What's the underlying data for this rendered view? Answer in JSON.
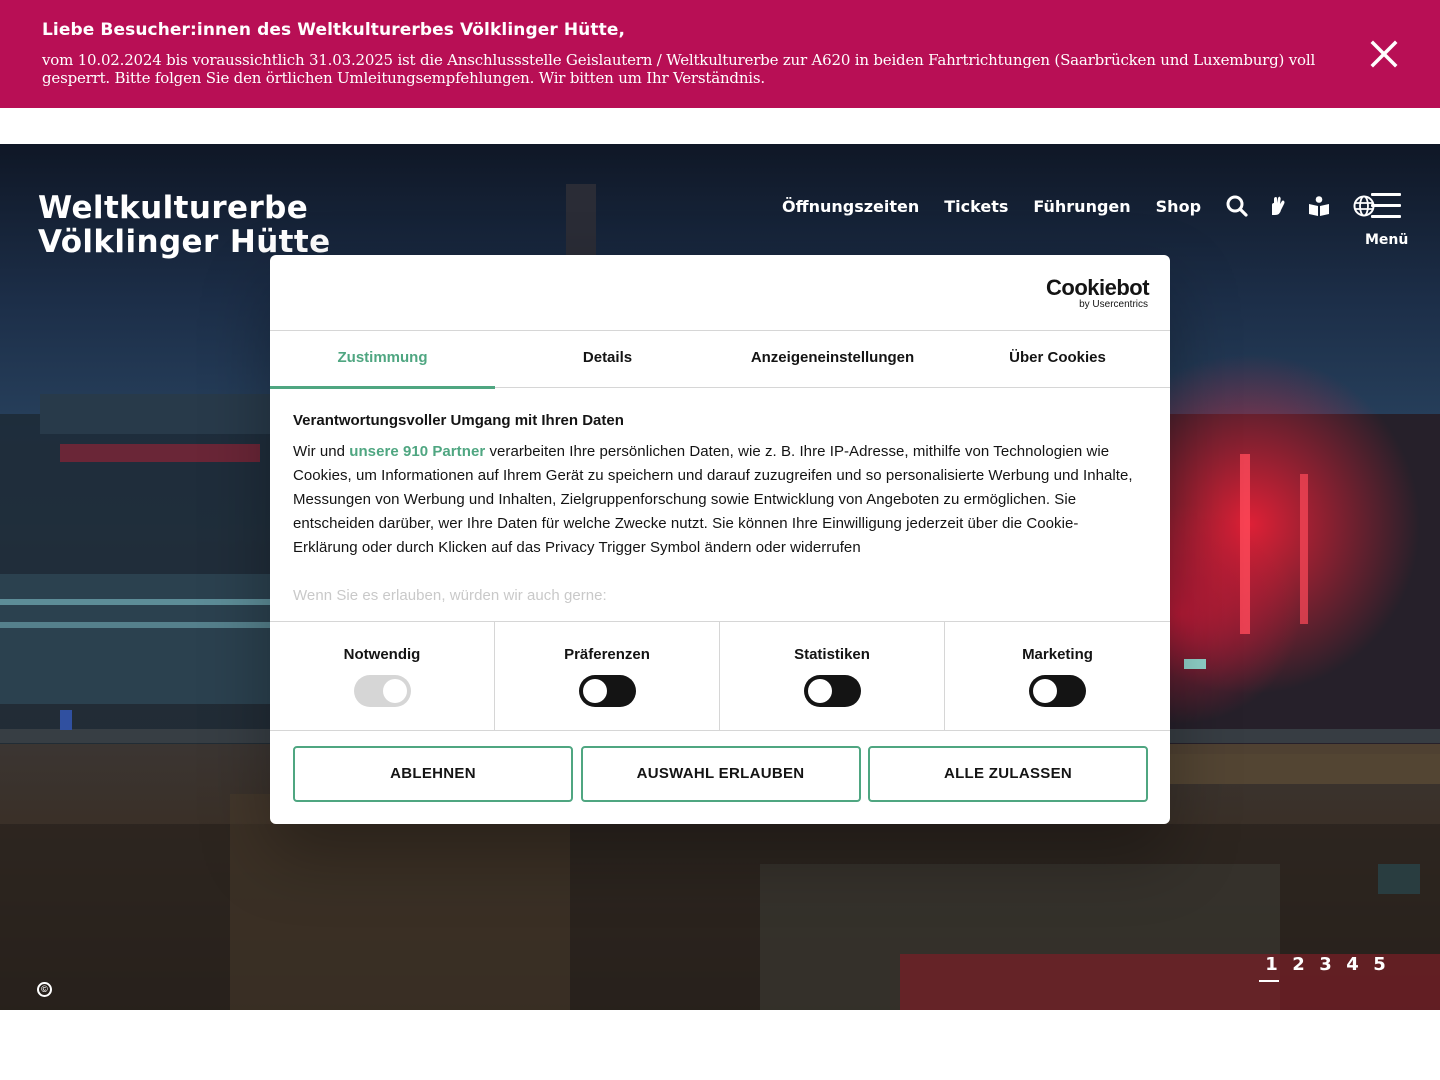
{
  "notice": {
    "title": "Liebe Besucher:innen des Weltkulturerbes Völklinger Hütte,",
    "text": "vom 10.02.2024 bis voraussichtlich 31.03.2025 ist die Anschlussstelle Geislautern / Weltkulturerbe zur A620 in beiden Fahrtrichtungen (Saarbrücken und Luxemburg) voll gesperrt. Bitte folgen Sie den örtlichen Umleitungsempfehlungen. Wir bitten um Ihr Verständnis.",
    "close_icon": "close-icon"
  },
  "site": {
    "logo_line1": "Weltkulturerbe",
    "logo_line2": "Völklinger Hütte"
  },
  "nav": {
    "links": [
      "Öffnungszeiten",
      "Tickets",
      "Führungen",
      "Shop"
    ],
    "icons": [
      "search-icon",
      "sign-language-icon",
      "easy-language-icon",
      "globe-icon"
    ],
    "menu_label": "Menü"
  },
  "hero": {
    "pages": [
      "1",
      "2",
      "3",
      "4",
      "5"
    ],
    "active_page": "1",
    "copyright_symbol": "©"
  },
  "cookie": {
    "brand": "Cookiebot",
    "brand_sub": "by Usercentrics",
    "tabs": [
      "Zustimmung",
      "Details",
      "Anzeigeneinstellungen",
      "Über Cookies"
    ],
    "active_tab": "Zustimmung",
    "heading": "Verantwortungsvoller Umgang mit Ihren Daten",
    "text_before_link": "Wir und ",
    "link_text": "unsere 910 Partner",
    "text_after_link": " verarbeiten Ihre persönlichen Daten, wie z. B. Ihre IP-Adresse, mithilfe von Technologien wie Cookies, um Informationen auf Ihrem Gerät zu speichern und darauf zuzugreifen und so personalisierte Werbung und Inhalte, Messungen von Werbung und Inhalten, Zielgruppenforschung sowie Entwicklung von Angeboten zu ermöglichen. Sie entscheiden darüber, wer Ihre Daten für welche Zwecke nutzt. Sie können Ihre Einwilligung jederzeit über die Cookie-Erklärung oder durch Klicken auf das Privacy Trigger Symbol ändern oder widerrufen",
    "faded_text": "Wenn Sie es erlauben, würden wir auch gerne:",
    "categories": [
      {
        "label": "Notwendig",
        "enabled": true,
        "locked": true
      },
      {
        "label": "Präferenzen",
        "enabled": false,
        "locked": false
      },
      {
        "label": "Statistiken",
        "enabled": false,
        "locked": false
      },
      {
        "label": "Marketing",
        "enabled": false,
        "locked": false
      }
    ],
    "buttons": {
      "reject": "ABLEHNEN",
      "allow_selection": "AUSWAHL ERLAUBEN",
      "allow_all": "ALLE ZULASSEN"
    },
    "accent_color": "#4fa681"
  },
  "colors": {
    "notice_bg": "#b80f55",
    "text_dark": "#141414"
  }
}
